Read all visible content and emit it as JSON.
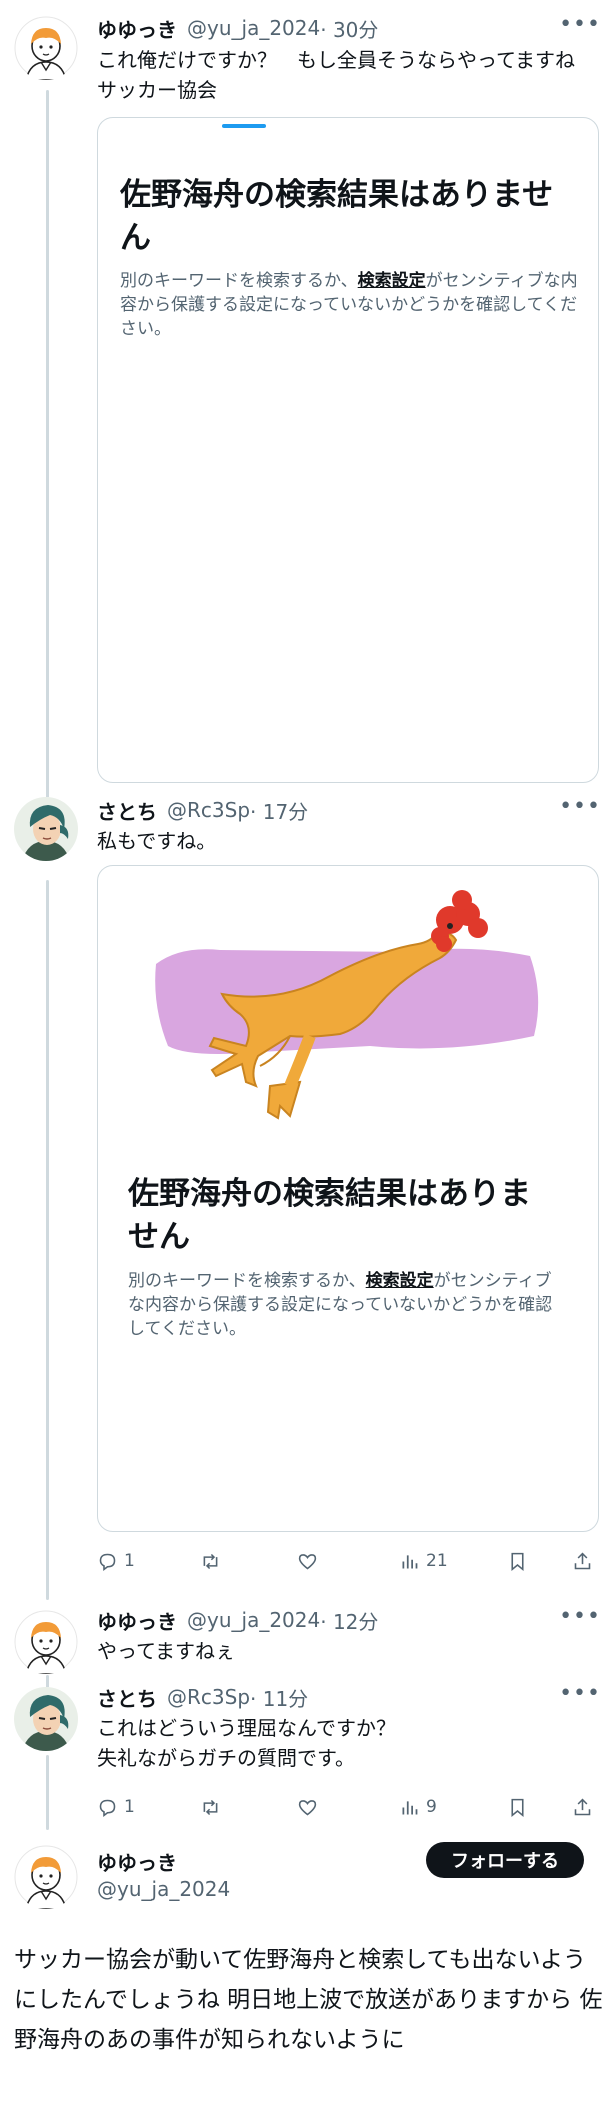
{
  "tweets": [
    {
      "name": "ゆゆっき",
      "handle": "@yu_ja_2024",
      "time": "· 30分",
      "text": "これ俺だけですか？　もし全員そうならやってますね　サッカー協会",
      "card": {
        "title": "佐野海舟の検索結果はありません",
        "desc_pre": "別のキーワードを検索するか、",
        "desc_link": "検索設定",
        "desc_post": "がセンシティブな内容から保護する設定になっていないかどうかを確認してください。"
      }
    },
    {
      "name": "さとち",
      "handle": "@Rc3Sp",
      "time": "· 17分",
      "text": "私もですね。",
      "card": {
        "title": "佐野海舟の検索結果はありません",
        "desc_pre": "別のキーワードを検索するか、",
        "desc_link": "検索設定",
        "desc_post": "がセンシティブな内容から保護する設定になっていないかどうかを確認してください。"
      },
      "actions": {
        "replies": "1",
        "retweets": "",
        "likes": "",
        "views": "21"
      }
    },
    {
      "name": "ゆゆっき",
      "handle": "@yu_ja_2024",
      "time": "· 12分",
      "text": "やってますねぇ"
    },
    {
      "name": "さとち",
      "handle": "@Rc3Sp",
      "time": "· 11分",
      "text_line1": "これはどういう理屈なんですか？",
      "text_line2": "失礼ながらガチの質問です。",
      "actions": {
        "replies": "1",
        "retweets": "",
        "likes": "",
        "views": "9"
      }
    }
  ],
  "main_post": {
    "name": "ゆゆっき",
    "handle": "@yu_ja_2024",
    "follow_label": "フォローする",
    "text": "サッカー協会が動いて佐野海舟と検索しても出ないようにしたんでしょうね 明日地上波で放送がありますから 佐野海舟のあの事件が知られないように"
  },
  "icons": {
    "more": "more-dots-icon",
    "reply": "reply-icon",
    "retweet": "retweet-icon",
    "like": "heart-icon",
    "views": "views-bar-chart-icon",
    "bookmark": "bookmark-icon",
    "share": "share-icon"
  },
  "colors": {
    "text": "#0f1419",
    "secondary": "#536471",
    "border": "#cfd9de",
    "accent": "#1d9bf0",
    "card_art_bg": "#d9a6e0",
    "chicken": "#f0a93a",
    "comb": "#e0392b"
  }
}
